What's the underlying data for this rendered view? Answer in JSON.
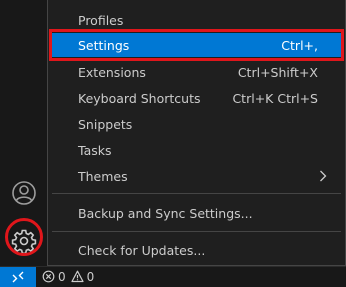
{
  "activity_bar": {
    "accounts_icon": "account-icon",
    "manage_icon": "gear-icon"
  },
  "menu": {
    "items": [
      {
        "label": "Profiles",
        "keybinding": ""
      },
      {
        "label": "Settings",
        "keybinding": "Ctrl+,",
        "selected": true
      },
      {
        "label": "Extensions",
        "keybinding": "Ctrl+Shift+X"
      },
      {
        "label": "Keyboard Shortcuts",
        "keybinding": "Ctrl+K Ctrl+S"
      },
      {
        "label": "Snippets",
        "keybinding": ""
      },
      {
        "label": "Tasks",
        "keybinding": ""
      },
      {
        "label": "Themes",
        "keybinding": "",
        "submenu": true
      },
      {
        "label": "Backup and Sync Settings...",
        "keybinding": ""
      },
      {
        "label": "Check for Updates...",
        "keybinding": ""
      }
    ]
  },
  "status_bar": {
    "remote_icon": "remote-icon",
    "errors": "0",
    "warnings": "0"
  },
  "colors": {
    "accent": "#0078d4",
    "highlight": "#e0161b",
    "menu_bg": "#1f1f1f",
    "bar_bg": "#181818"
  }
}
